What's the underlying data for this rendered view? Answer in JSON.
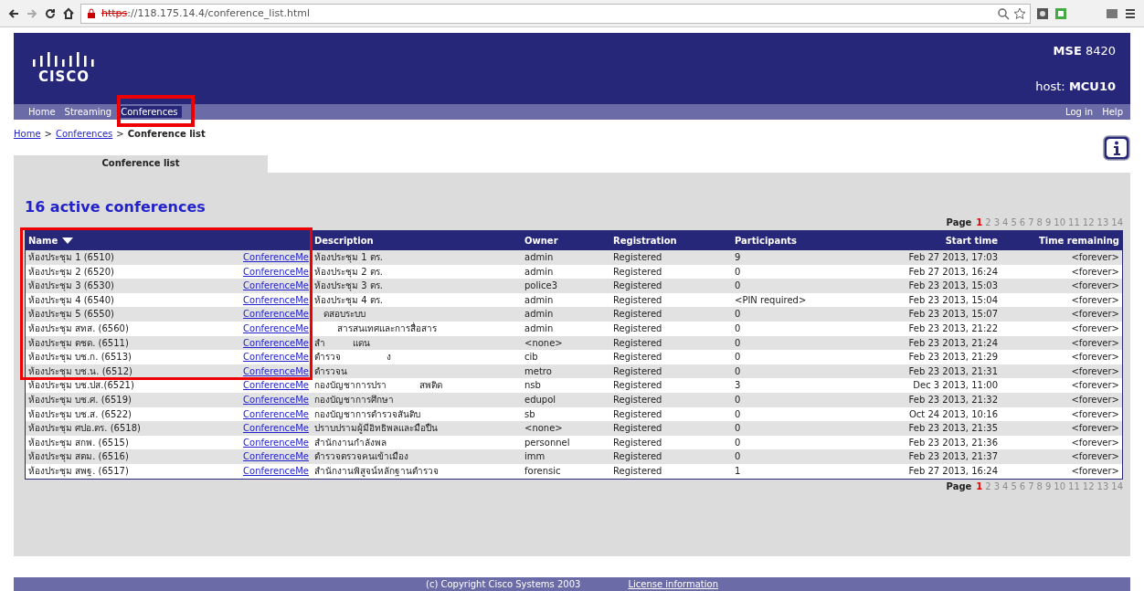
{
  "browser": {
    "url_scheme": "https",
    "url_rest": "://118.175.14.4/conference_list.html"
  },
  "header": {
    "logo": "CISCO",
    "product_bold": "MSE",
    "product_model": "8420",
    "host_label": "host:",
    "host_name": "MCU10"
  },
  "nav": {
    "left": [
      {
        "label": "Home",
        "selected": false
      },
      {
        "label": "Streaming",
        "selected": false
      },
      {
        "label": "Conferences",
        "selected": true
      }
    ],
    "right": [
      "Log in",
      "Help"
    ]
  },
  "breadcrumb": {
    "separator": ">",
    "items": [
      {
        "label": "Home",
        "link": true
      },
      {
        "label": "Conferences",
        "link": true
      },
      {
        "label": "Conference list",
        "link": false
      }
    ]
  },
  "tab": "Conference list",
  "heading": "16 active conferences",
  "pagination_top": {
    "label": "Page",
    "pages": [
      {
        "label": "1",
        "selected": true
      },
      {
        "label": "2",
        "selected": false
      },
      {
        "label": "3",
        "selected": false
      },
      {
        "label": "4",
        "selected": false
      },
      {
        "label": "5",
        "selected": false
      },
      {
        "label": "6",
        "selected": false
      },
      {
        "label": "7",
        "selected": false
      },
      {
        "label": "8",
        "selected": false
      },
      {
        "label": "9",
        "selected": false
      },
      {
        "label": "10",
        "selected": false
      },
      {
        "label": "11",
        "selected": false
      },
      {
        "label": "12",
        "selected": false
      },
      {
        "label": "13",
        "selected": false
      },
      {
        "label": "14",
        "selected": false
      }
    ]
  },
  "table": {
    "columns": [
      {
        "label": "Name",
        "sorted": true
      },
      {
        "label": "Description",
        "sorted": false
      },
      {
        "label": "Owner",
        "sorted": false
      },
      {
        "label": "Registration",
        "sorted": false
      },
      {
        "label": "Participants",
        "sorted": false
      },
      {
        "label": "Start time",
        "sorted": false
      },
      {
        "label": "Time remaining",
        "sorted": false
      }
    ],
    "rows": [
      {
        "name": "ห้องประชุม 1 (6510)",
        "link": "ConferenceMe",
        "description": [
          "ห้องประชุม 1 ตร."
        ],
        "owner": "admin",
        "registration": "Registered",
        "participants": "9",
        "start_time": "Feb 27 2013, 17:03",
        "time_remaining": "<forever>"
      },
      {
        "name": "ห้องประชุม 2 (6520)",
        "link": "ConferenceMe",
        "description": [
          "ห้องประชุม 2 ตร."
        ],
        "owner": "admin",
        "registration": "Registered",
        "participants": "0",
        "start_time": "Feb 27 2013, 16:24",
        "time_remaining": "<forever>"
      },
      {
        "name": "ห้องประชุม 3 (6530)",
        "link": "ConferenceMe",
        "description": [
          "ห้องประชุม 3 ตร."
        ],
        "owner": "police3",
        "registration": "Registered",
        "participants": "0",
        "start_time": "Feb 23 2013, 15:03",
        "time_remaining": "<forever>"
      },
      {
        "name": "ห้องประชุม 4 (6540)",
        "link": "ConferenceMe",
        "description": [
          "ห้องประชุม 4 ตร."
        ],
        "owner": "admin",
        "registration": "Registered",
        "participants": "<PIN required>",
        "start_time": "Feb 23 2013, 15:04",
        "time_remaining": "<forever>"
      },
      {
        "name": "ห้องประชุม 5 (6550)",
        "link": "ConferenceMe",
        "description": [
          "ดสอบระบบ"
        ],
        "owner": "admin",
        "registration": "Registered",
        "participants": "0",
        "start_time": "Feb 23 2013, 15:07",
        "time_remaining": "<forever>"
      },
      {
        "name": "ห้องประชุม สทส. (6560)",
        "link": "ConferenceMe",
        "description": [
          "สารสนเทศและการสื่อสาร"
        ],
        "owner": "admin",
        "registration": "Registered",
        "participants": "0",
        "start_time": "Feb 23 2013, 21:22",
        "time_remaining": "<forever>"
      },
      {
        "name": "ห้องประชุม ตชด. (6511)",
        "link": "ConferenceMe",
        "description": [
          "สำ",
          "แดน"
        ],
        "owner": "<none>",
        "registration": "Registered",
        "participants": "0",
        "start_time": "Feb 23 2013, 21:24",
        "time_remaining": "<forever>"
      },
      {
        "name": "ห้องประชุม บช.ก. (6513)",
        "link": "ConferenceMe",
        "description": [
          "ตำรวจ",
          "ง"
        ],
        "owner": "cib",
        "registration": "Registered",
        "participants": "0",
        "start_time": "Feb 23 2013, 21:29",
        "time_remaining": "<forever>"
      },
      {
        "name": "ห้องประชุม บช.น. (6512)",
        "link": "ConferenceMe",
        "description": [
          "ตำรวจน"
        ],
        "owner": "metro",
        "registration": "Registered",
        "participants": "0",
        "start_time": "Feb 23 2013, 21:31",
        "time_remaining": "<forever>"
      },
      {
        "name": "ห้องประชุม บช.ปส.(6521)",
        "link": "ConferenceMe",
        "description": [
          "กองบัญชาการปรา",
          "สพติด"
        ],
        "owner": "nsb",
        "registration": "Registered",
        "participants": "3",
        "start_time": "Dec 3 2013, 11:00",
        "time_remaining": "<forever>"
      },
      {
        "name": "ห้องประชุม บช.ศ. (6519)",
        "link": "ConferenceMe",
        "description": [
          "กองบัญชาการศึกษา"
        ],
        "owner": "edupol",
        "registration": "Registered",
        "participants": "0",
        "start_time": "Feb 23 2013, 21:32",
        "time_remaining": "<forever>"
      },
      {
        "name": "ห้องประชุม บช.ส. (6522)",
        "link": "ConferenceMe",
        "description": [
          "กองบัญชาการตำรวจสันติบ"
        ],
        "owner": "sb",
        "registration": "Registered",
        "participants": "0",
        "start_time": "Oct 24 2013, 10:16",
        "time_remaining": "<forever>"
      },
      {
        "name": "ห้องประชุม ศปอ.ตร. (6518)",
        "link": "ConferenceMe",
        "description": [
          "ปราบปรามผู้มีอิทธิพลและมือปืน"
        ],
        "owner": "<none>",
        "registration": "Registered",
        "participants": "0",
        "start_time": "Feb 23 2013, 21:35",
        "time_remaining": "<forever>"
      },
      {
        "name": "ห้องประชุม สกพ. (6515)",
        "link": "ConferenceMe",
        "description": [
          "สำนักงานกำลังพล"
        ],
        "owner": "personnel",
        "registration": "Registered",
        "participants": "0",
        "start_time": "Feb 23 2013, 21:36",
        "time_remaining": "<forever>"
      },
      {
        "name": "ห้องประชุม สตม. (6516)",
        "link": "ConferenceMe",
        "description": [
          "ตำรวจตรวจคนเข้าเมือง"
        ],
        "owner": "imm",
        "registration": "Registered",
        "participants": "0",
        "start_time": "Feb 23 2013, 21:37",
        "time_remaining": "<forever>"
      },
      {
        "name": "ห้องประชุม สพฐ. (6517)",
        "link": "ConferenceMe",
        "description": [
          "สำนักงานพิสูจน์หลักฐานตำรวจ"
        ],
        "owner": "forensic",
        "registration": "Registered",
        "participants": "1",
        "start_time": "Feb 27 2013, 16:24",
        "time_remaining": "<forever>"
      }
    ]
  },
  "pagination_bottom": {
    "label": "Page",
    "pages": [
      {
        "label": "1",
        "selected": true
      },
      {
        "label": "2",
        "selected": false
      },
      {
        "label": "3",
        "selected": false
      },
      {
        "label": "4",
        "selected": false
      },
      {
        "label": "5",
        "selected": false
      },
      {
        "label": "6",
        "selected": false
      },
      {
        "label": "7",
        "selected": false
      },
      {
        "label": "8",
        "selected": false
      },
      {
        "label": "9",
        "selected": false
      },
      {
        "label": "10",
        "selected": false
      },
      {
        "label": "11",
        "selected": false
      },
      {
        "label": "12",
        "selected": false
      },
      {
        "label": "13",
        "selected": false
      },
      {
        "label": "14",
        "selected": false
      }
    ]
  },
  "footer": {
    "text": "(c) Copyright Cisco Systems 2003",
    "link": "License information"
  }
}
